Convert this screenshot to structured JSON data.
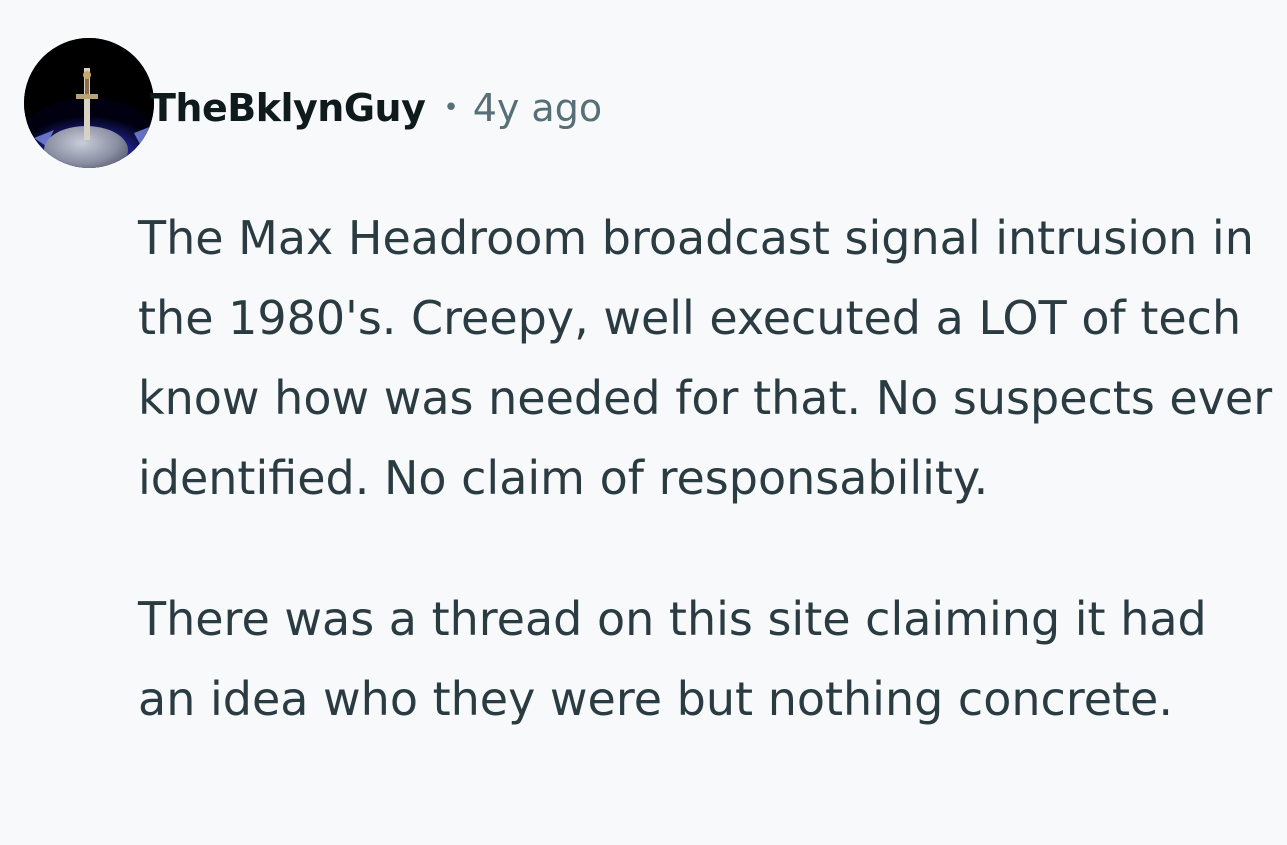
{
  "comment": {
    "author": "TheBklynGuy",
    "separator": "•",
    "timestamp": "4y ago",
    "avatar_icon": "sword-in-stone-icon",
    "paragraphs": [
      "The Max Headroom broadcast signal intrusion in the 1980's. Creepy, well executed a LOT of tech know how was needed for that. No suspects ever identified. No claim of responsability.",
      "There was a thread on this site claiming it had an idea who they were but nothing concrete."
    ]
  },
  "colors": {
    "background": "#f7f9fb",
    "author": "#0f1a1c",
    "meta": "#576f76",
    "body_text": "#2a3c42"
  }
}
